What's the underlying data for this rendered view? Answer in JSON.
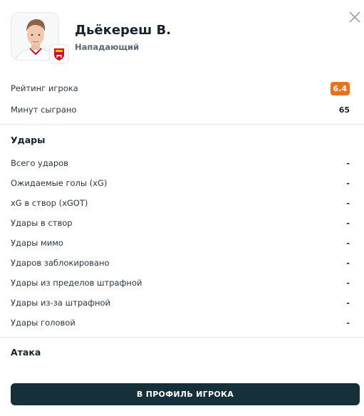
{
  "player": {
    "name": "Дьёкереш В.",
    "position": "Нападающий"
  },
  "summary": [
    {
      "label": "Рейтинг игрока",
      "value": "6.4",
      "badge_color": "#e8721c"
    },
    {
      "label": "Минут сыграно",
      "value": "65"
    }
  ],
  "shots_section": {
    "title": "Удары",
    "rows": [
      {
        "label": "Всего ударов",
        "value": "-"
      },
      {
        "label": "Ожидаемые голы (xG)",
        "value": "-"
      },
      {
        "label": "xG в створ (xGOT)",
        "value": "-"
      },
      {
        "label": "Удары в створ",
        "value": "-"
      },
      {
        "label": "Удары мимо",
        "value": "-"
      },
      {
        "label": "Ударов заблокировано",
        "value": "-"
      },
      {
        "label": "Удары из пределов штрафной",
        "value": "-"
      },
      {
        "label": "Удары из-за штрафной",
        "value": "-"
      },
      {
        "label": "Удары головой",
        "value": "-"
      }
    ]
  },
  "attack_section": {
    "title": "Атака"
  },
  "cta": {
    "label": "В ПРОФИЛЬ ИГРОКА",
    "color": "#15303a"
  },
  "icons": {
    "close": "close-icon",
    "club": "arsenal-crest-icon",
    "photo": "player-photo"
  }
}
